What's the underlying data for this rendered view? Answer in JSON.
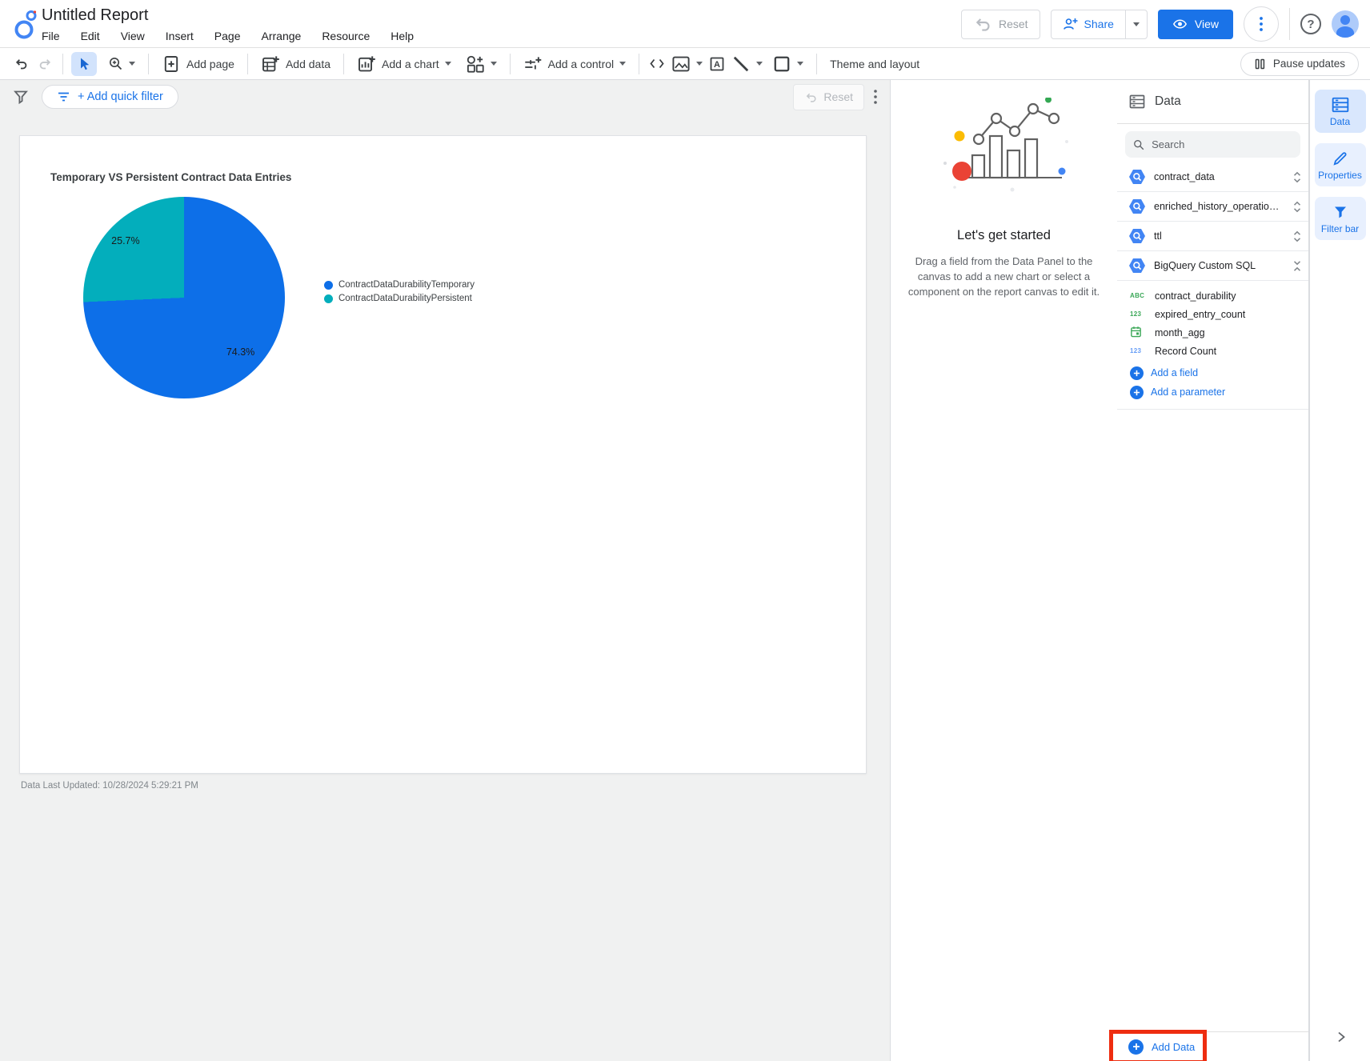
{
  "app": {
    "title": "Untitled Report"
  },
  "menu": {
    "items": [
      "File",
      "Edit",
      "View",
      "Insert",
      "Page",
      "Arrange",
      "Resource",
      "Help"
    ]
  },
  "header_actions": {
    "reset": "Reset",
    "share": "Share",
    "view": "View"
  },
  "toolbar": {
    "add_page": "Add page",
    "add_data": "Add data",
    "add_chart": "Add a chart",
    "add_control": "Add a control",
    "theme": "Theme and layout",
    "pause": "Pause updates"
  },
  "filter_bar": {
    "quick_filter": "+ Add quick filter",
    "reset": "Reset"
  },
  "canvas": {
    "updated_note": "Data Last Updated: 10/28/2024 5:29:21 PM"
  },
  "chart_data": {
    "type": "pie",
    "title": "Temporary VS Persistent Contract Data Entries",
    "categories": [
      "ContractDataDurabilityTemporary",
      "ContractDataDurabilityPersistent"
    ],
    "values": [
      74.3,
      25.7
    ],
    "labels": [
      "74.3%",
      "25.7%"
    ],
    "colors": [
      "#0d6fe8",
      "#03aebc"
    ],
    "legend_position": "right"
  },
  "getting_started": {
    "title": "Let's get started",
    "body": "Drag a field from the Data Panel to the canvas to add a new chart or select a component on the report canvas to edit it."
  },
  "data_panel": {
    "title": "Data",
    "search_placeholder": "Search",
    "sources": [
      {
        "name": "contract_data"
      },
      {
        "name": "enriched_history_operations_sorob..."
      },
      {
        "name": "ttl"
      },
      {
        "name": "BigQuery Custom SQL"
      }
    ],
    "fields": [
      {
        "name": "contract_durability",
        "icon_text": "ABC",
        "type": "text"
      },
      {
        "name": "expired_entry_count",
        "icon_text": "123",
        "type": "number"
      },
      {
        "name": "month_agg",
        "icon_text": "",
        "type": "date"
      },
      {
        "name": "Record Count",
        "icon_text": "123",
        "type": "metric"
      }
    ],
    "add_field": "Add a field",
    "add_parameter": "Add a parameter",
    "add_data": "Add Data"
  },
  "right_rail": {
    "tabs": [
      {
        "label": "Data"
      },
      {
        "label": "Properties"
      },
      {
        "label": "Filter bar"
      }
    ]
  }
}
